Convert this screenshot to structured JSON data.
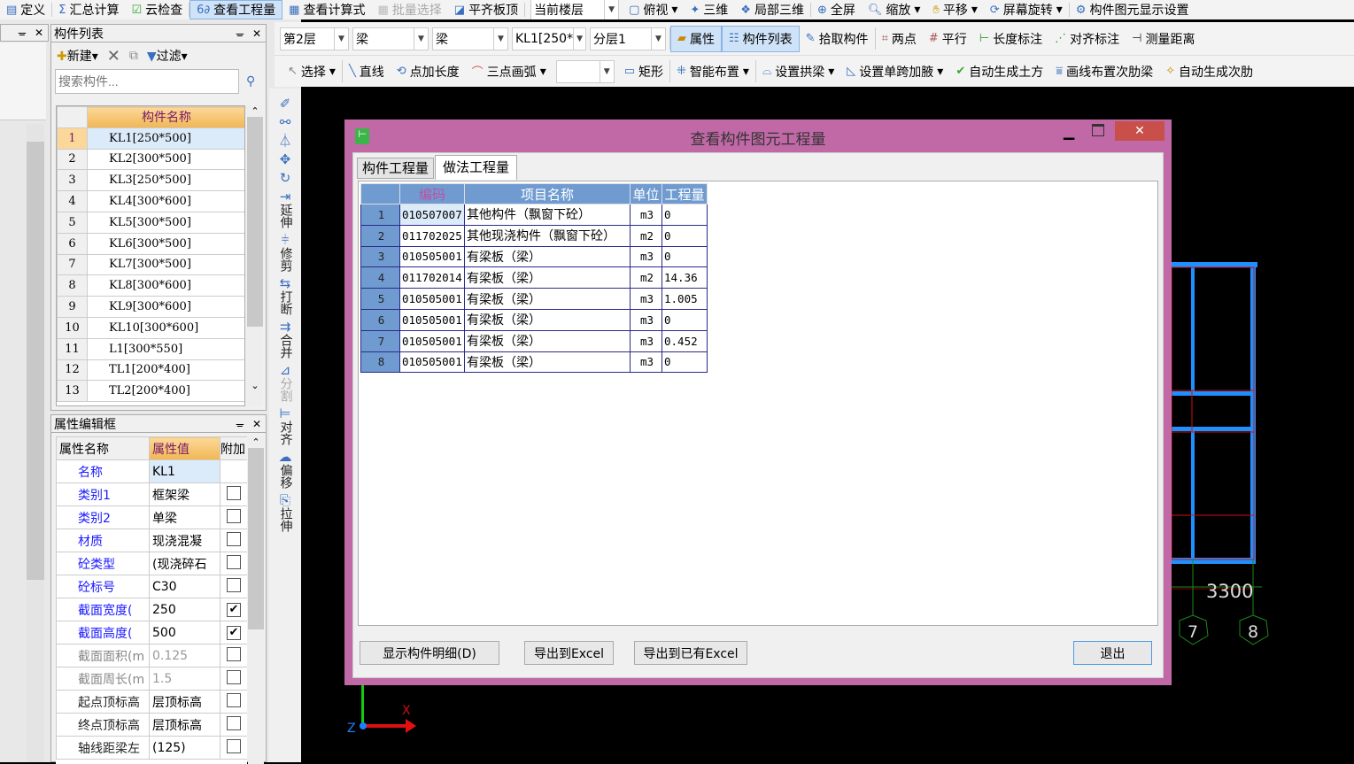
{
  "toolbar_top": {
    "items": [
      "定义",
      "汇总计算",
      "云检查",
      "查看工程量",
      "查看计算式",
      "批量选择",
      "平齐板顶"
    ],
    "current_floor": "当前楼层",
    "view_items": [
      "俯视",
      "三维",
      "局部三维",
      "全屏",
      "缩放",
      "平移",
      "屏幕旋转",
      "构件图元显示设置"
    ]
  },
  "toolbar_filters": {
    "floor": "第2层",
    "type1": "梁",
    "type2": "梁",
    "component": "KL1[250*",
    "layer": "分层1"
  },
  "toolbar_panels": [
    "属性",
    "构件列表",
    "拾取构件",
    "两点",
    "平行",
    "长度标注",
    "对齐标注",
    "测量距离"
  ],
  "toolbar_draw": {
    "select": "选择",
    "items": [
      "直线",
      "点加长度",
      "三点画弧"
    ],
    "combo": "",
    "items2": [
      "矩形",
      "智能布置",
      "设置拱梁",
      "设置单跨加腋",
      "自动生成土方",
      "画线布置次肋梁",
      "自动生成次肋"
    ]
  },
  "component_list": {
    "title": "构件列表",
    "new": "新建",
    "filter": "过滤",
    "search_placeholder": "搜索构件...",
    "column": "构件名称",
    "rows": [
      "KL1[250*500]",
      "KL2[300*500]",
      "KL3[250*500]",
      "KL4[300*600]",
      "KL5[300*500]",
      "KL6[300*500]",
      "KL7[300*500]",
      "KL8[300*600]",
      "KL9[300*600]",
      "KL10[300*600]",
      "L1[300*550]",
      "TL1[200*400]",
      "TL2[200*400]"
    ],
    "row_numbers": [
      "1",
      "2",
      "3",
      "4",
      "5",
      "6",
      "7",
      "8",
      "9",
      "10",
      "11",
      "12",
      "13"
    ]
  },
  "property_editor": {
    "title": "属性编辑框",
    "columns": [
      "属性名称",
      "属性值",
      "附加"
    ],
    "rows": [
      {
        "name": "名称",
        "value": "KL1",
        "checked": null
      },
      {
        "name": "类别1",
        "value": "框架梁",
        "checked": false
      },
      {
        "name": "类别2",
        "value": "单梁",
        "checked": false
      },
      {
        "name": "材质",
        "value": "现浇混凝",
        "checked": false
      },
      {
        "name": "砼类型",
        "value": "(现浇碎石",
        "checked": false
      },
      {
        "name": "砼标号",
        "value": "C30",
        "checked": false
      },
      {
        "name": "截面宽度(",
        "value": "250",
        "checked": true
      },
      {
        "name": "截面高度(",
        "value": "500",
        "checked": true
      },
      {
        "name": "截面面积(m",
        "value": "0.125",
        "checked": false
      },
      {
        "name": "截面周长(m",
        "value": "1.5",
        "checked": false
      },
      {
        "name": "起点顶标高",
        "value": "层顶标高",
        "checked": false
      },
      {
        "name": "终点顶标高",
        "value": "层顶标高",
        "checked": false
      },
      {
        "name": "轴线距梁左",
        "value": "(125)",
        "checked": false
      }
    ]
  },
  "vertical_toolbar": [
    "延伸",
    "修剪",
    "打断",
    "合并",
    "分割",
    "对齐",
    "偏移",
    "拉伸"
  ],
  "dialog": {
    "title": "查看构件图元工程量",
    "tabs": [
      "构件工程量",
      "做法工程量"
    ],
    "active_tab": 1,
    "columns": [
      "编码",
      "项目名称",
      "单位",
      "工程量"
    ],
    "rows": [
      [
        "1",
        "010507007",
        "其他构件（飘窗下砼）",
        "m3",
        "0"
      ],
      [
        "2",
        "011702025",
        "其他现浇构件（飘窗下砼）",
        "m2",
        "0"
      ],
      [
        "3",
        "010505001",
        "有梁板（梁）",
        "m3",
        "0"
      ],
      [
        "4",
        "011702014",
        "有梁板（梁）",
        "m2",
        "14.36"
      ],
      [
        "5",
        "010505001",
        "有梁板（梁）",
        "m3",
        "1.005"
      ],
      [
        "6",
        "010505001",
        "有梁板（梁）",
        "m3",
        "0"
      ],
      [
        "7",
        "010505001",
        "有梁板（梁）",
        "m3",
        "0.452"
      ],
      [
        "8",
        "010505001",
        "有梁板（梁）",
        "m3",
        "0"
      ]
    ],
    "buttons": {
      "detail": "显示构件明细(D)",
      "export": "导出到Excel",
      "export_existing": "导出到已有Excel",
      "exit": "退出"
    }
  },
  "canvas": {
    "dimension": "3300",
    "axes": [
      "7",
      "8"
    ],
    "axis_x": "X",
    "axis_z": "Z"
  },
  "colors": {
    "dialog_border": "#c069a6",
    "close": "#c9504a",
    "table_header": "#6f9bd1",
    "beam": "#1e90ff"
  }
}
